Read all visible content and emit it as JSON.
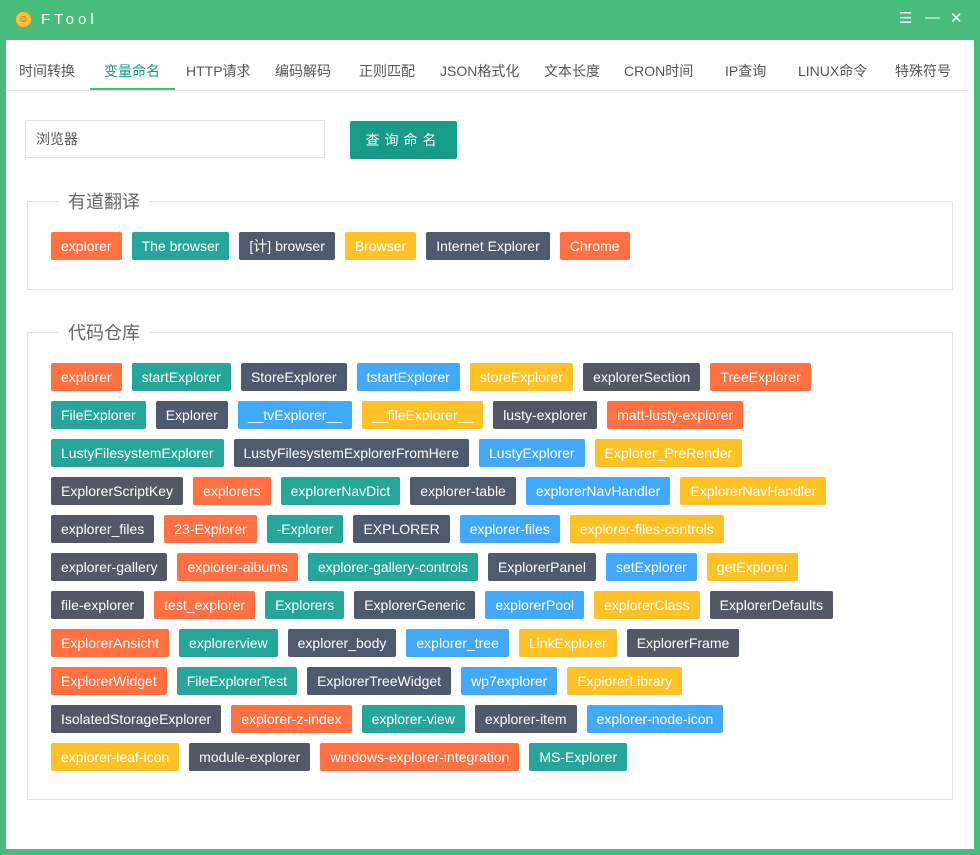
{
  "window": {
    "title": "FTool",
    "logo_icon": "smiley-icon"
  },
  "tabs": [
    "时间转换",
    "变量命名",
    "HTTP请求",
    "编码解码",
    "正则匹配",
    "JSON格式化",
    "文本长度",
    "CRON时间",
    "IP查询",
    "LINUX命令",
    "特殊符号"
  ],
  "active_tab": 1,
  "search": {
    "value": "浏览器",
    "button": "查询命名"
  },
  "youdao": {
    "title": "有道翻译",
    "rows": [
      [
        [
          "explorer",
          "o"
        ],
        [
          "The browser",
          "t"
        ],
        [
          "[计] browser",
          "d"
        ],
        [
          "Browser",
          "y"
        ],
        [
          "Internet Explorer",
          "d"
        ],
        [
          "Chrome",
          "o"
        ]
      ]
    ]
  },
  "code": {
    "title": "代码仓库",
    "rows": [
      [
        [
          "explorer",
          "o"
        ],
        [
          "startExplorer",
          "t"
        ],
        [
          "StoreExplorer",
          "d"
        ],
        [
          "tstartExplorer",
          "b"
        ],
        [
          "storeExplorer",
          "y"
        ],
        [
          "explorerSection",
          "g"
        ],
        [
          "TreeExplorer",
          "o"
        ]
      ],
      [
        [
          "FileExplorer",
          "t"
        ],
        [
          "Explorer",
          "d"
        ],
        [
          "__tvExplorer__",
          "b"
        ],
        [
          "__fileExplorer__",
          "y"
        ],
        [
          "lusty-explorer",
          "g"
        ],
        [
          "matt-lusty-explorer",
          "o"
        ]
      ],
      [
        [
          "LustyFilesystemExplorer",
          "t"
        ],
        [
          "LustyFilesystemExplorerFromHere",
          "d"
        ],
        [
          "LustyExplorer",
          "b"
        ],
        [
          "Explorer_PreRender",
          "y"
        ]
      ],
      [
        [
          "ExplorerScriptKey",
          "g"
        ],
        [
          "explorers",
          "o"
        ],
        [
          "explorerNavDict",
          "t"
        ],
        [
          "explorer-table",
          "d"
        ],
        [
          "explorerNavHandler",
          "b"
        ],
        [
          "ExplorerNavHandler",
          "y"
        ]
      ],
      [
        [
          "explorer_files",
          "g"
        ],
        [
          "23-Explorer",
          "o"
        ],
        [
          "-Explorer",
          "t"
        ],
        [
          "EXPLORER",
          "d"
        ],
        [
          "explorer-files",
          "b"
        ],
        [
          "explorer-files-controls",
          "y"
        ]
      ],
      [
        [
          "explorer-gallery",
          "g"
        ],
        [
          "explorer-albums",
          "o"
        ],
        [
          "explorer-gallery-controls",
          "t"
        ],
        [
          "ExplorerPanel",
          "d"
        ],
        [
          "setExplorer",
          "b"
        ],
        [
          "getExplorer",
          "y"
        ]
      ],
      [
        [
          "file-explorer",
          "g"
        ],
        [
          "test_explorer",
          "o"
        ],
        [
          "Explorers",
          "t"
        ],
        [
          "ExplorerGeneric",
          "d"
        ],
        [
          "explorerPool",
          "b"
        ],
        [
          "explorerClass",
          "y"
        ],
        [
          "ExplorerDefaults",
          "g"
        ]
      ],
      [
        [
          "ExplorerAnsicht",
          "o"
        ],
        [
          "explorerview",
          "t"
        ],
        [
          "explorer_body",
          "d"
        ],
        [
          "explorer_tree",
          "b"
        ],
        [
          "LinkExplorer",
          "y"
        ],
        [
          "ExplorerFrame",
          "g"
        ]
      ],
      [
        [
          "ExplorerWidget",
          "o"
        ],
        [
          "FileExplorerTest",
          "t"
        ],
        [
          "ExplorerTreeWidget",
          "d"
        ],
        [
          "wp7explorer",
          "b"
        ],
        [
          "ExplorerLibrary",
          "y"
        ]
      ],
      [
        [
          "IsolatedStorageExplorer",
          "g"
        ],
        [
          "explorer-z-index",
          "o"
        ],
        [
          "explorer-view",
          "t"
        ],
        [
          "explorer-item",
          "d"
        ],
        [
          "explorer-node-icon",
          "b"
        ]
      ],
      [
        [
          "explorer-leaf-icon",
          "y"
        ],
        [
          "module-explorer",
          "g"
        ],
        [
          "windows-explorer-integration",
          "o"
        ],
        [
          "MS-Explorer",
          "t"
        ]
      ]
    ]
  },
  "colors": {
    "o": "#ff7043",
    "t": "#26a69a",
    "d": "#4e5a6e",
    "g": "#545866",
    "b": "#42a9f8",
    "y": "#ffc226",
    "frame": "#48bd7b",
    "button": "#169c88"
  }
}
